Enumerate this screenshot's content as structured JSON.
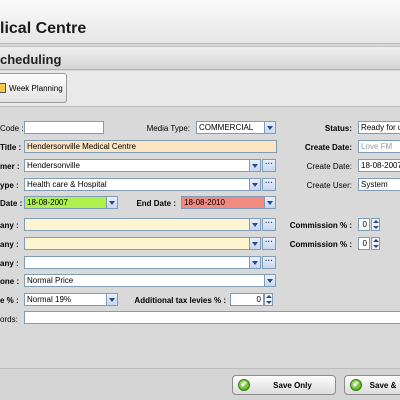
{
  "window": {
    "title": "lical Centre"
  },
  "section": {
    "title": "cheduling"
  },
  "toolbar": {
    "week_planning": "Week Planning"
  },
  "form": {
    "code_label": "Code :",
    "code_value": "",
    "media_type_label": "Media Type:",
    "media_type_value": "COMMERCIAL",
    "status_label": "Status:",
    "status_value": "Ready for u",
    "title_label": "Title :",
    "title_value": "Hendersonville Medical Centre",
    "create_date_label_1": "Create Date:",
    "create_date_value_1": "Love FM",
    "customer_label": "mer :",
    "customer_value": "Hendersonville",
    "create_date_label_2": "Create Date:",
    "create_date_value_2": "18-08-2007",
    "type_label": "ype :",
    "type_value": "Health care & Hospital",
    "create_user_label": "Create User:",
    "create_user_value": "System",
    "start_date_label": "Date :",
    "start_date_value": "18-08-2007",
    "end_date_label": "End Date :",
    "end_date_value": "18-08-2010",
    "company1_label": "any :",
    "company1_value": "",
    "commission1_label": "Commission % :",
    "commission1_value": "0",
    "company2_label": "any :",
    "company2_value": "",
    "commission2_label": "Commission % :",
    "commission2_value": "0",
    "company3_label": "any :",
    "company3_value": "",
    "zone_label": "one :",
    "zone_value": "Normal Price",
    "tax_label": "e % :",
    "tax_value": "Normal 19%",
    "levies_label": "Additional tax levies % :",
    "levies_value": "0",
    "keywords_label": "ords:",
    "keywords_value": ""
  },
  "footer": {
    "save_only": "Save Only",
    "save_and": "Save &"
  }
}
